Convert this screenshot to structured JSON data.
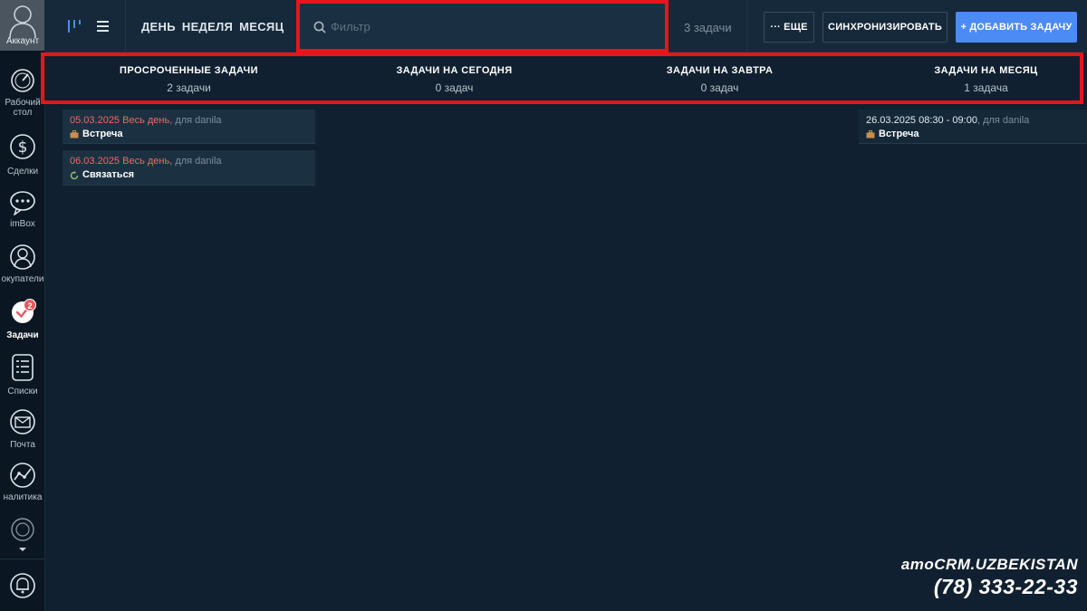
{
  "sidebar": {
    "account_label": "Аккаунт",
    "items": [
      {
        "label_l1": "Рабочий",
        "label_l2": "стол",
        "icon": "dashboard-icon"
      },
      {
        "label_l1": "Сделки",
        "icon": "dollar-icon"
      },
      {
        "label_l1": "imBox",
        "icon": "chat-icon"
      },
      {
        "label_l1": "окупатели",
        "icon": "customers-icon"
      },
      {
        "label_l1": "Задачи",
        "icon": "tasks-check-icon",
        "active": true
      },
      {
        "label_l1": "Списки",
        "icon": "lists-icon"
      },
      {
        "label_l1": "Почта",
        "icon": "mail-icon"
      },
      {
        "label_l1": "налитика",
        "icon": "analytics-icon"
      }
    ],
    "tasks_badge": "2",
    "more_icon": "more-nav-icon",
    "bell_icon": "bell-icon"
  },
  "header": {
    "period_tabs": [
      "ДЕНЬ",
      "НЕДЕЛЯ",
      "МЕСЯЦ"
    ],
    "search_placeholder": "Фильтр",
    "task_count": "3 задачи",
    "more_label": "··· ЕЩЕ",
    "sync_label": "СИНХРОНИЗИРОВАТЬ",
    "add_label": "+ ДОБАВИТЬ ЗАДАЧУ"
  },
  "columns": [
    {
      "title": "ПРОСРОЧЕННЫЕ ЗАДАЧИ",
      "count": "2 задачи"
    },
    {
      "title": "ЗАДАЧИ НА СЕГОДНЯ",
      "count": "0 задач"
    },
    {
      "title": "ЗАДАЧИ НА ЗАВТРА",
      "count": "0 задач"
    },
    {
      "title": "ЗАДАЧИ НА МЕСЯЦ",
      "count": "1 задача"
    }
  ],
  "tasks": {
    "overdue": [
      {
        "date": "05.03.2025 Весь день",
        "for": ", для",
        "user": "danila",
        "type": "Встреча",
        "type_icon": "briefcase-icon"
      },
      {
        "date": "06.03.2025 Весь день",
        "for": ", для",
        "user": "danila",
        "type": "Связаться",
        "type_icon": "refresh-icon"
      }
    ],
    "month": [
      {
        "date": "26.03.2025 08:30 - 09:00",
        "for": ", для",
        "user": "danila",
        "type": "Встреча",
        "type_icon": "briefcase-icon"
      }
    ]
  },
  "watermark": {
    "name": "amoCRM.UZBEKISTAN",
    "phone": "(78) 333-22-33"
  },
  "colors": {
    "background": "#102030",
    "sidebar": "#0a1722",
    "topbar": "#15293a",
    "card": "#1b3142",
    "overdue_date": "#ec6a62",
    "accent_button": "#4c8bf5",
    "highlight": "#e8141b"
  }
}
